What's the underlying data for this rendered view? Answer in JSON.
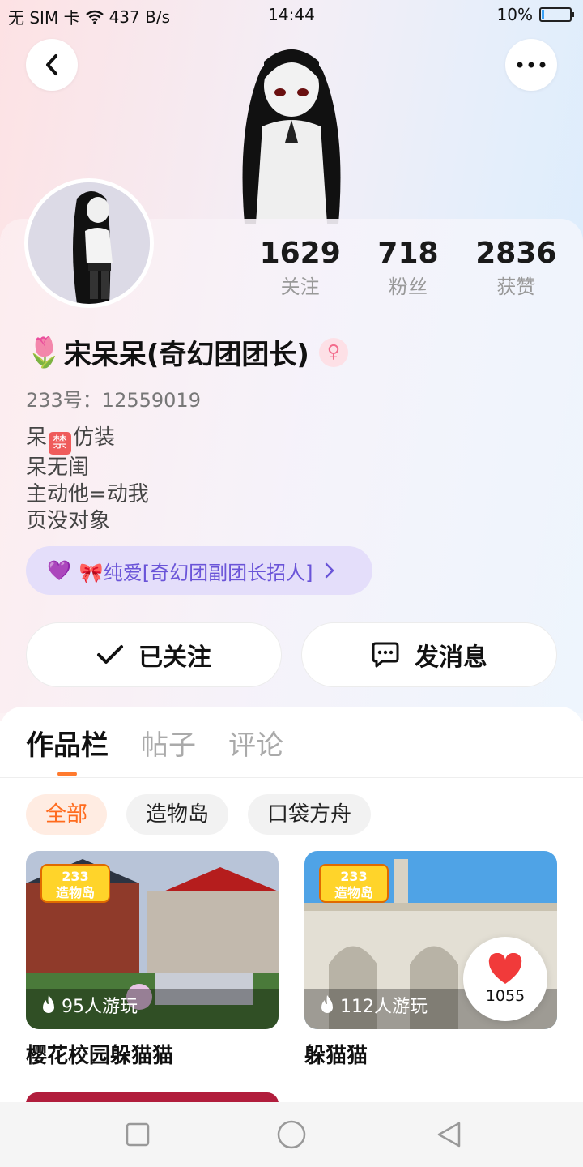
{
  "status_bar": {
    "carrier": "无 SIM 卡",
    "speed": "437 B/s",
    "time": "14:44",
    "battery": "10%",
    "battery_level": 0.1
  },
  "profile": {
    "name": "宋呆呆(奇幻团团长)",
    "name_emoji": "🌷",
    "uid": "233号：12559019",
    "bio_lines": [
      "呆",
      "仿装",
      "呆无闺",
      "主动他=动我",
      "页没对象"
    ],
    "bio_badge": "禁",
    "group": {
      "icon": "💜",
      "label": "🎀纯爱[奇幻团副团长招人]"
    }
  },
  "stats": [
    {
      "value": "1629",
      "label": "关注"
    },
    {
      "value": "718",
      "label": "粉丝"
    },
    {
      "value": "2836",
      "label": "获赞"
    }
  ],
  "actions": {
    "follow_label": "已关注",
    "message_label": "发消息"
  },
  "tabs": [
    "作品栏",
    "帖子",
    "评论"
  ],
  "chips": [
    "全部",
    "造物岛",
    "口袋方舟"
  ],
  "cards": [
    {
      "logo": "233\n造物岛",
      "plays": "95人游玩",
      "title": "樱花校园躲猫猫"
    },
    {
      "logo": "233\n造物岛",
      "plays": "112人游玩",
      "title": "躲猫猫"
    }
  ],
  "like_count": "1055",
  "colors": {
    "accent": "#ff7a2e",
    "group_text": "#6a54d8",
    "gender": "#f36c8c"
  }
}
